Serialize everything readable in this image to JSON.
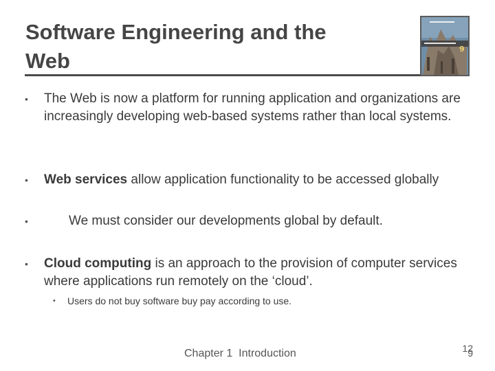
{
  "title": {
    "line1": "Software Engineering and the",
    "line2": "Web"
  },
  "book_cover": {
    "icon": "book-cover-image",
    "edition": "9",
    "colors": {
      "sky": "#6f8ea8",
      "building": "#8a7a6a",
      "band": "#3d3d3d"
    }
  },
  "bullets": [
    {
      "bold": "",
      "text": "The Web is now a platform for running application and organizations are increasingly developing web-based systems rather than local systems."
    },
    {
      "bold": "Web services",
      "text": " allow application functionality to be accessed globally"
    },
    {
      "bold": "",
      "text": "We must consider our developments global by default."
    },
    {
      "bold": "Cloud computing",
      "text": " is an approach to the provision of computer services where applications run remotely on the ‘cloud’."
    }
  ],
  "sub_bullet": {
    "text": "Users do not buy software buy pay according to use."
  },
  "footer": {
    "chapter": "Chapter 1",
    "section": "Introduction"
  },
  "page_number": {
    "current": "12",
    "other": "9"
  },
  "bullet_glyph": "•"
}
